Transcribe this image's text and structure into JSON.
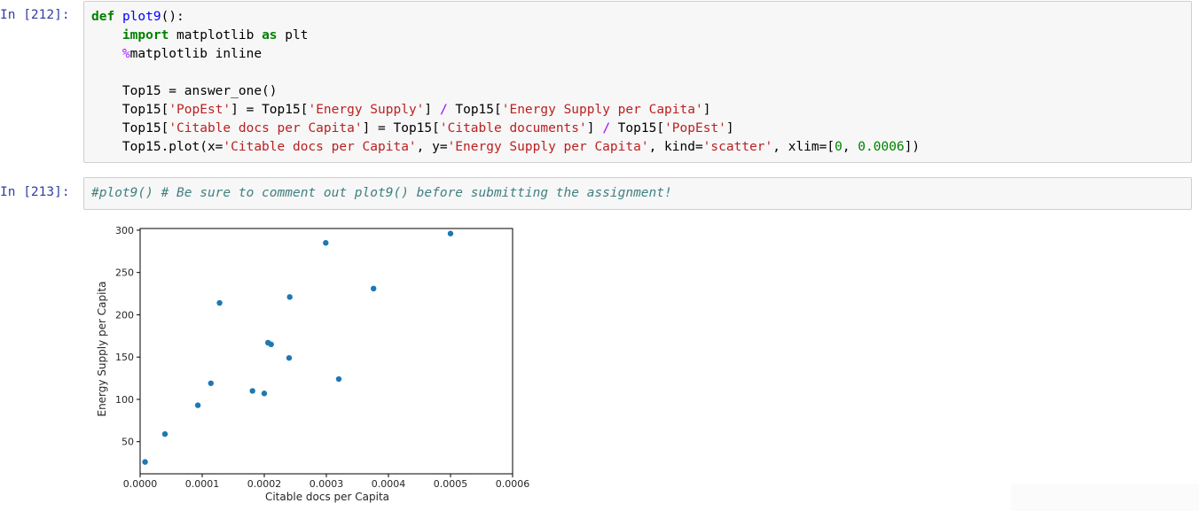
{
  "cells": [
    {
      "prompt": "In [212]:",
      "lines": [
        [
          {
            "t": "def",
            "c": "kw"
          },
          {
            "t": " "
          },
          {
            "t": "plot9",
            "c": "fn"
          },
          {
            "t": "():"
          }
        ],
        [
          {
            "t": "    "
          },
          {
            "t": "import",
            "c": "kw"
          },
          {
            "t": " matplotlib "
          },
          {
            "t": "as",
            "c": "kw"
          },
          {
            "t": " plt"
          }
        ],
        [
          {
            "t": "    "
          },
          {
            "t": "%",
            "c": "pct"
          },
          {
            "t": "matplotlib inline"
          }
        ],
        [
          {
            "t": ""
          }
        ],
        [
          {
            "t": "    Top15 = answer_one()"
          }
        ],
        [
          {
            "t": "    Top15["
          },
          {
            "t": "'PopEst'",
            "c": "st"
          },
          {
            "t": "] = Top15["
          },
          {
            "t": "'Energy Supply'",
            "c": "st"
          },
          {
            "t": "] "
          },
          {
            "t": "/",
            "c": "op"
          },
          {
            "t": " Top15["
          },
          {
            "t": "'Energy Supply per Capita'",
            "c": "st"
          },
          {
            "t": "]"
          }
        ],
        [
          {
            "t": "    Top15["
          },
          {
            "t": "'Citable docs per Capita'",
            "c": "st"
          },
          {
            "t": "] = Top15["
          },
          {
            "t": "'Citable documents'",
            "c": "st"
          },
          {
            "t": "] "
          },
          {
            "t": "/",
            "c": "op"
          },
          {
            "t": " Top15["
          },
          {
            "t": "'PopEst'",
            "c": "st"
          },
          {
            "t": "]"
          }
        ],
        [
          {
            "t": "    Top15.plot(x="
          },
          {
            "t": "'Citable docs per Capita'",
            "c": "st"
          },
          {
            "t": ", y="
          },
          {
            "t": "'Energy Supply per Capita'",
            "c": "st"
          },
          {
            "t": ", kind="
          },
          {
            "t": "'scatter'",
            "c": "st"
          },
          {
            "t": ", xlim=["
          },
          {
            "t": "0",
            "c": "nm"
          },
          {
            "t": ", "
          },
          {
            "t": "0.0006",
            "c": "nm"
          },
          {
            "t": "])"
          }
        ]
      ]
    },
    {
      "prompt": "In [213]:",
      "lines": [
        [
          {
            "t": "#plot9() # Be sure to comment out plot9() before submitting the assignment!",
            "c": "cm"
          }
        ]
      ]
    }
  ],
  "chart_data": {
    "type": "scatter",
    "xlabel": "Citable docs per Capita",
    "ylabel": "Energy Supply per Capita",
    "xlim": [
      0,
      0.0006
    ],
    "ylim": [
      12,
      302
    ],
    "xticks": [
      "0.0000",
      "0.0001",
      "0.0002",
      "0.0003",
      "0.0004",
      "0.0005",
      "0.0006"
    ],
    "xtick_values": [
      0,
      0.0001,
      0.0002,
      0.0003,
      0.0004,
      0.0005,
      0.0006
    ],
    "yticks": [
      "50",
      "100",
      "150",
      "200",
      "250",
      "300"
    ],
    "ytick_values": [
      50,
      100,
      150,
      200,
      250,
      300
    ],
    "point_color": "#1f77b4",
    "grid": false,
    "points": [
      {
        "x": 8e-06,
        "y": 26
      },
      {
        "x": 4e-05,
        "y": 59
      },
      {
        "x": 9.3e-05,
        "y": 93
      },
      {
        "x": 0.000114,
        "y": 119
      },
      {
        "x": 0.000128,
        "y": 214
      },
      {
        "x": 0.000181,
        "y": 110
      },
      {
        "x": 0.0002,
        "y": 107
      },
      {
        "x": 0.000206,
        "y": 167
      },
      {
        "x": 0.000211,
        "y": 165
      },
      {
        "x": 0.00024,
        "y": 149
      },
      {
        "x": 0.000241,
        "y": 221
      },
      {
        "x": 0.000299,
        "y": 285
      },
      {
        "x": 0.00032,
        "y": 124
      },
      {
        "x": 0.000376,
        "y": 231
      },
      {
        "x": 0.0005,
        "y": 296
      }
    ]
  }
}
